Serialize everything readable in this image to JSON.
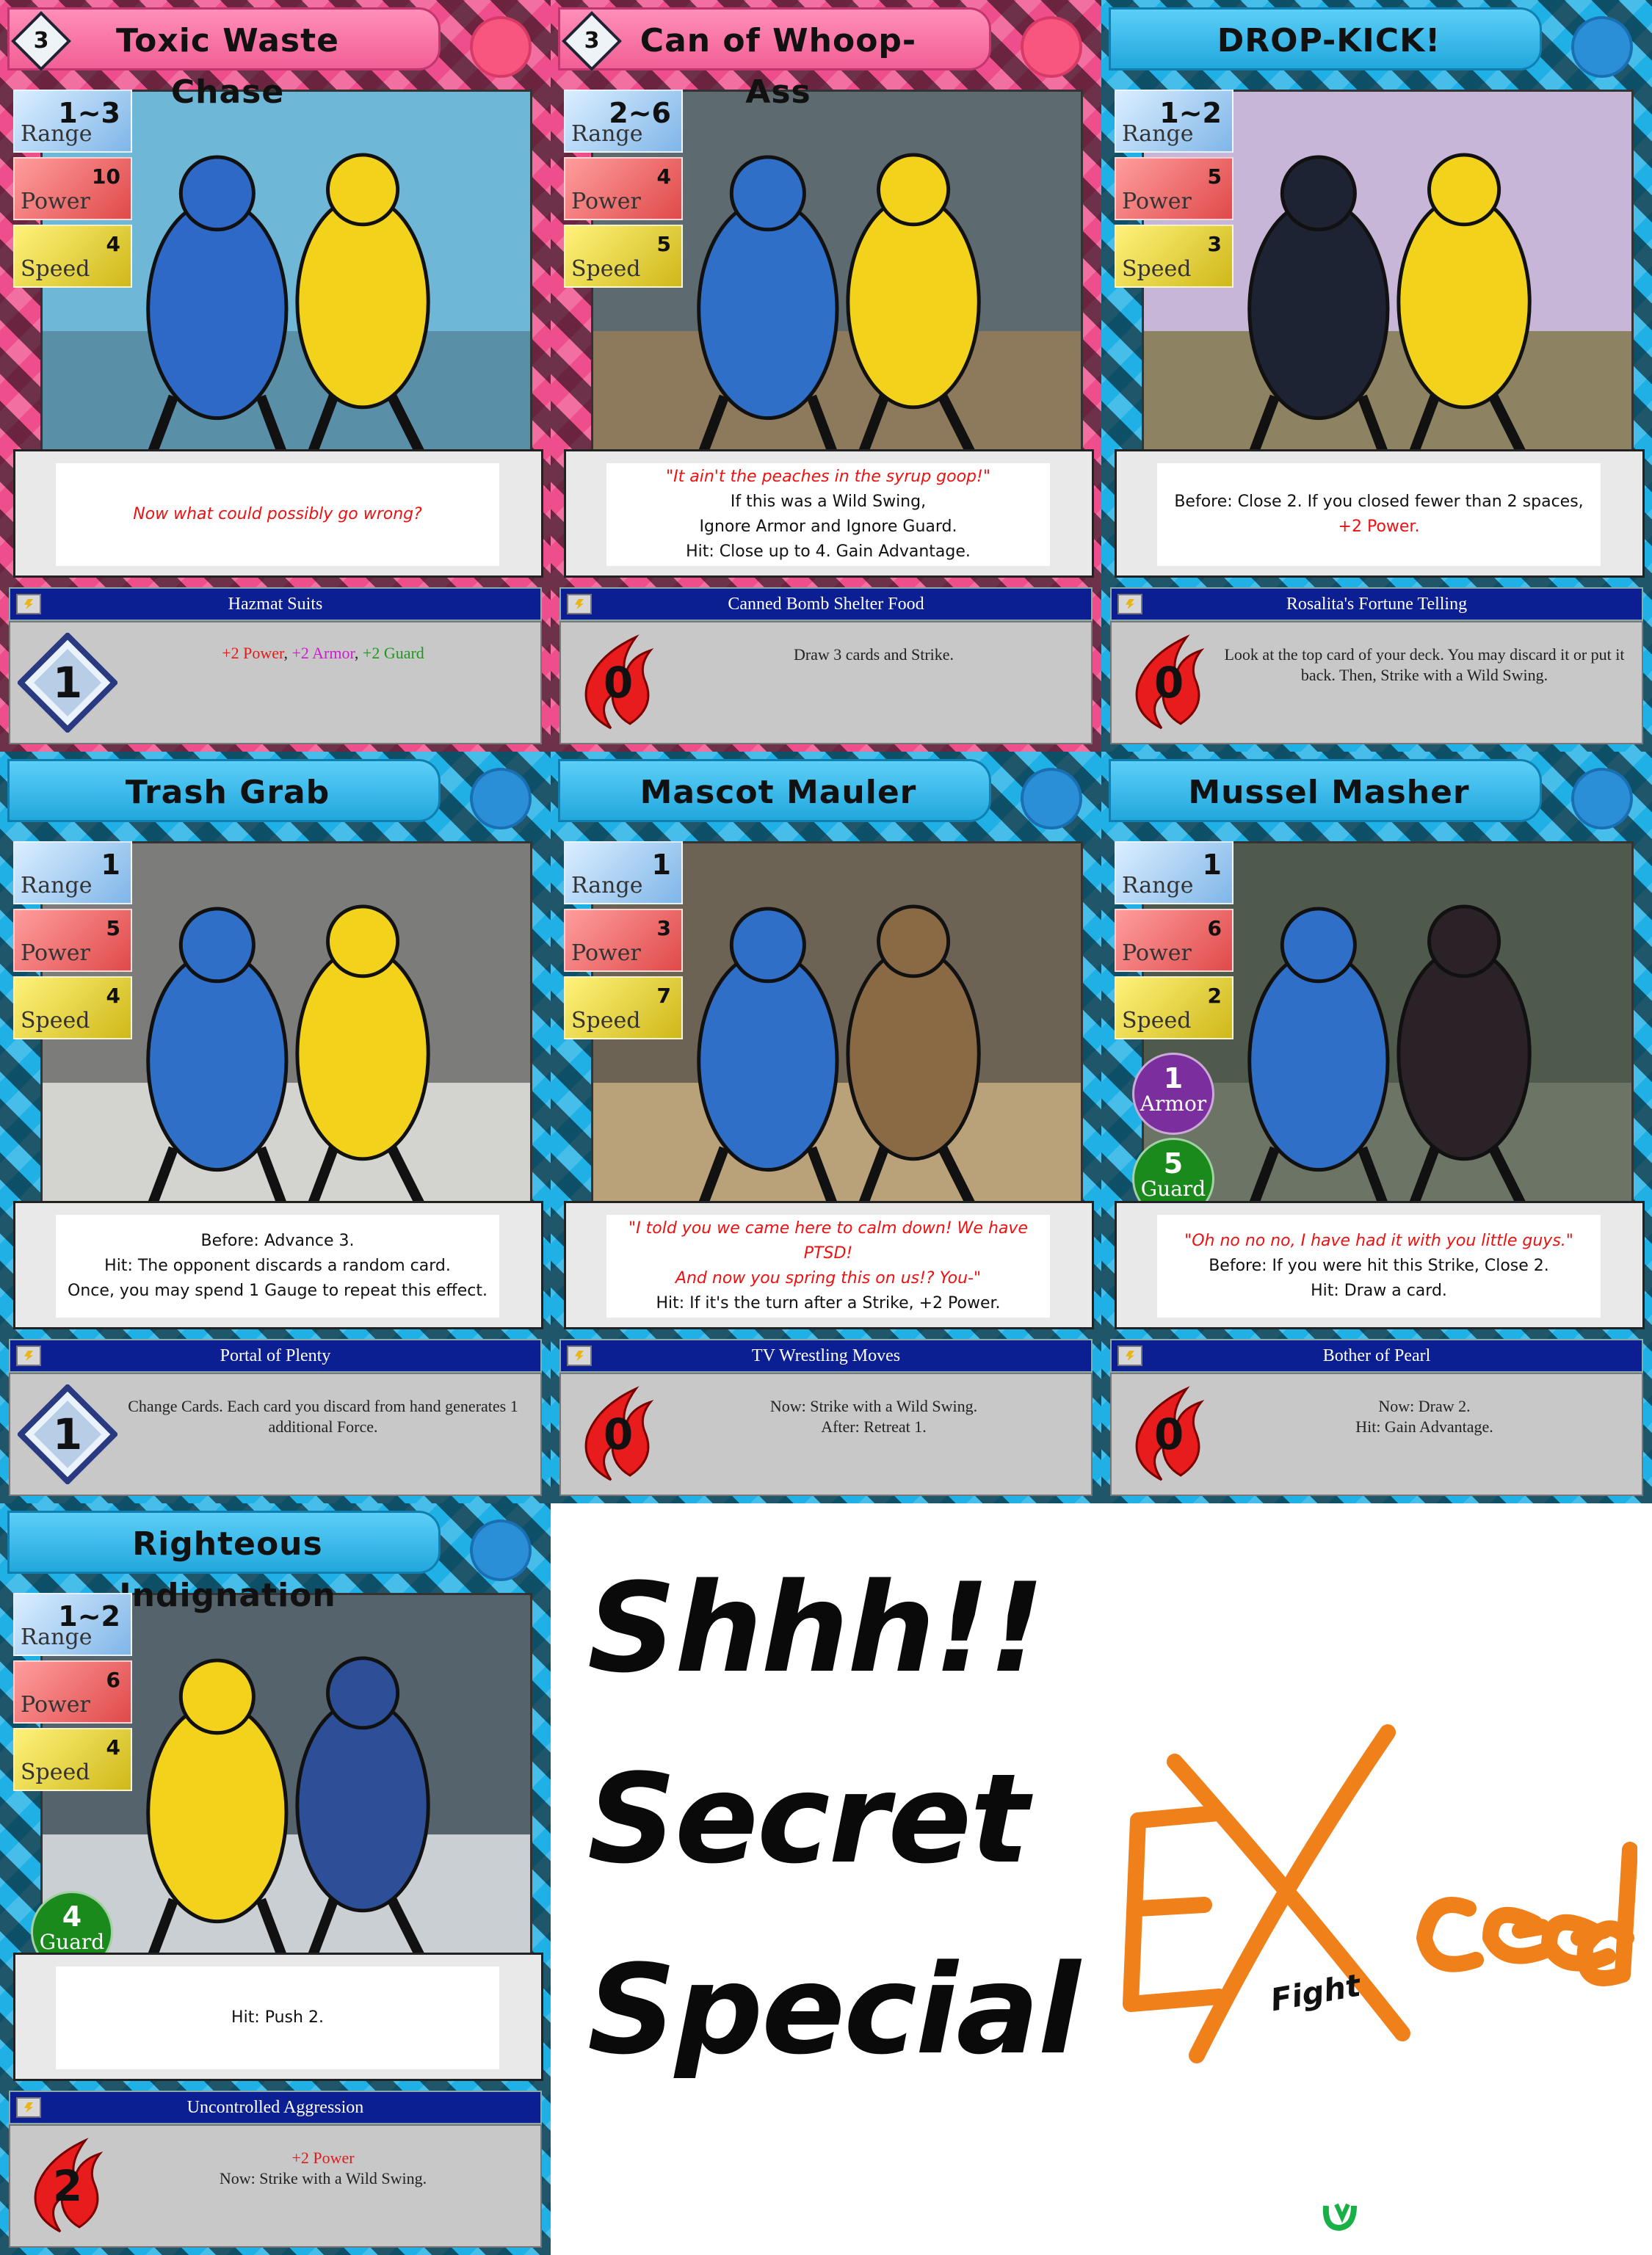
{
  "cards": [
    {
      "title": "Toxic Waste Chase",
      "cost": "3",
      "theme": "pink",
      "range": "1~3",
      "power": "10",
      "speed": "4",
      "armor": null,
      "guard": null,
      "labels": {
        "range": "Range",
        "power": "Power",
        "speed": "Speed",
        "armor": "Armor",
        "guard": "Guard"
      },
      "text_lines": [
        {
          "text": "Now what could possibly go wrong?",
          "style": "quote"
        }
      ],
      "boost": {
        "name": "Hazmat Suits",
        "cost": "1",
        "cost_shape": "diamond",
        "segments": [
          {
            "text": "+2 Power",
            "style": "pow"
          },
          {
            "text": ", ",
            "style": "plain"
          },
          {
            "text": "+2 Armor",
            "style": "arm"
          },
          {
            "text": ", ",
            "style": "plain"
          },
          {
            "text": "+2 Guard",
            "style": "grd"
          }
        ],
        "big": true
      }
    },
    {
      "title": "Can of Whoop-Ass",
      "cost": "3",
      "theme": "pink",
      "range": "2~6",
      "power": "4",
      "speed": "5",
      "armor": null,
      "guard": null,
      "labels": {
        "range": "Range",
        "power": "Power",
        "speed": "Speed",
        "armor": "Armor",
        "guard": "Guard"
      },
      "text_lines": [
        {
          "text": "\"It ain't the peaches in the syrup goop!\"",
          "style": "quote"
        },
        {
          "text": "If this was a Wild Swing,",
          "style": "plain"
        },
        {
          "text": "Ignore Armor and Ignore Guard.",
          "style": "plain"
        },
        {
          "text": "Hit: Close up to 4. Gain Advantage.",
          "style": "plain"
        }
      ],
      "boost": {
        "name": "Canned Bomb Shelter Food",
        "cost": "0",
        "cost_shape": "flame",
        "segments": [
          {
            "text": "Draw 3 cards and Strike.",
            "style": "plain"
          }
        ],
        "big": false
      }
    },
    {
      "title": "DROP-KICK!",
      "cost": "",
      "theme": "blue",
      "range": "1~2",
      "power": "5",
      "speed": "3",
      "armor": null,
      "guard": null,
      "labels": {
        "range": "Range",
        "power": "Power",
        "speed": "Speed",
        "armor": "Armor",
        "guard": "Guard"
      },
      "text_lines": [
        {
          "text": "Before: Close 2. If you closed fewer than 2 spaces,",
          "style": "plain"
        },
        {
          "text": "+2 Power.",
          "style": "hi"
        }
      ],
      "boost": {
        "name": "Rosalita's Fortune Telling",
        "cost": "0",
        "cost_shape": "flame",
        "segments": [
          {
            "text": "Look at the top card of your deck. You may discard it or put it back. Then, Strike with a Wild Swing.",
            "style": "plain"
          }
        ],
        "big": false
      }
    },
    {
      "title": "Trash Grab",
      "cost": "",
      "theme": "blue",
      "range": "1",
      "power": "5",
      "speed": "4",
      "armor": null,
      "guard": null,
      "labels": {
        "range": "Range",
        "power": "Power",
        "speed": "Speed",
        "armor": "Armor",
        "guard": "Guard"
      },
      "text_lines": [
        {
          "text": "Before: Advance 3.",
          "style": "plain"
        },
        {
          "text": "Hit: The opponent discards a random card.",
          "style": "plain"
        },
        {
          "text": "Once, you may spend 1 Gauge to repeat this effect.",
          "style": "plain"
        }
      ],
      "boost": {
        "name": "Portal of Plenty",
        "cost": "1",
        "cost_shape": "diamond",
        "segments": [
          {
            "text": "Change Cards. Each card you discard from hand generates 1 additional Force.",
            "style": "plain"
          }
        ],
        "big": false
      }
    },
    {
      "title": "Mascot Mauler",
      "cost": "",
      "theme": "blue",
      "range": "1",
      "power": "3",
      "speed": "7",
      "armor": null,
      "guard": null,
      "labels": {
        "range": "Range",
        "power": "Power",
        "speed": "Speed",
        "armor": "Armor",
        "guard": "Guard"
      },
      "text_lines": [
        {
          "text": "\"I told you we came here to calm down! We have PTSD!",
          "style": "quote"
        },
        {
          "text": "And now you spring this on us!? You-\"",
          "style": "quote"
        },
        {
          "text": "Hit: If it's the turn after a Strike, +2 Power.",
          "style": "plain"
        }
      ],
      "boost": {
        "name": "TV Wrestling Moves",
        "cost": "0",
        "cost_shape": "flame",
        "segments": [
          {
            "text": "Now: Strike with a Wild Swing.",
            "style": "plain"
          },
          {
            "text": "After: Retreat 1.",
            "style": "plain"
          }
        ],
        "big": false,
        "stacked": true
      }
    },
    {
      "title": "Mussel Masher",
      "cost": "",
      "theme": "blue",
      "range": "1",
      "power": "6",
      "speed": "2",
      "armor": "1",
      "guard": "5",
      "labels": {
        "range": "Range",
        "power": "Power",
        "speed": "Speed",
        "armor": "Armor",
        "guard": "Guard"
      },
      "text_lines": [
        {
          "text": "\"Oh no no no, I have had it with you little guys.\"",
          "style": "quote"
        },
        {
          "text": "Before: If you were hit this Strike, Close 2.",
          "style": "plain"
        },
        {
          "text": "Hit: Draw a card.",
          "style": "plain"
        }
      ],
      "boost": {
        "name": "Bother of Pearl",
        "cost": "0",
        "cost_shape": "flame",
        "segments": [
          {
            "text": "Now: Draw 2.",
            "style": "plain"
          },
          {
            "text": "Hit: Gain Advantage.",
            "style": "plain"
          }
        ],
        "big": false,
        "stacked": true
      }
    },
    {
      "title": "Righteous Indignation",
      "cost": "",
      "theme": "blue",
      "range": "1~2",
      "power": "6",
      "speed": "4",
      "armor": null,
      "guard": "4",
      "labels": {
        "range": "Range",
        "power": "Power",
        "speed": "Speed",
        "armor": "Armor",
        "guard": "Guard"
      },
      "text_lines": [
        {
          "text": "Hit: Push 2.",
          "style": "plain"
        }
      ],
      "boost": {
        "name": "Uncontrolled Aggression",
        "cost": "2",
        "cost_shape": "flame",
        "segments": [
          {
            "text": "+2 Power",
            "style": "pow"
          },
          {
            "text": "Now: Strike with a Wild Swing.",
            "style": "plain"
          }
        ],
        "big": false,
        "stacked": true
      }
    }
  ],
  "secret": {
    "line1": "Shhh!!",
    "line2": "Secret",
    "line3": "Special"
  },
  "logo": {
    "text": "Exceed",
    "sub": "Fight"
  },
  "colors": {
    "accent_blue": "#1fb0e6",
    "accent_pink": "#ee4f8c",
    "power_text": "#e21a1a",
    "armor_text": "#d21ad2",
    "guard_text": "#1d9a1d"
  }
}
